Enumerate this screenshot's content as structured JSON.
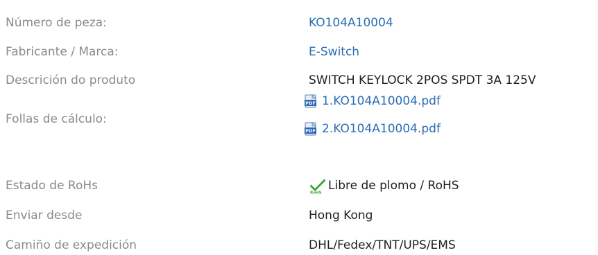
{
  "rows": {
    "part_number": {
      "label": "Número de peza:",
      "value": "KO104A10004"
    },
    "manufacturer": {
      "label": "Fabricante / Marca:",
      "value": "E-Switch"
    },
    "description": {
      "label": "Descrición do produto",
      "value": "SWITCH KEYLOCK 2POS SPDT 3A 125V"
    },
    "datasheets": {
      "label": "Follas de cálculo:",
      "files": [
        "1.KO104A10004.pdf",
        "2.KO104A10004.pdf"
      ],
      "icon": "pdf-icon"
    },
    "rohs": {
      "label": "Estado de RoHs",
      "value": "Libre de plomo / RoHS",
      "icon": "rohs-check-icon"
    },
    "ship_from": {
      "label": "Enviar desde",
      "value": "Hong Kong"
    },
    "shipping": {
      "label": "Camiño de expedición",
      "value": "DHL/Fedex/TNT/UPS/EMS"
    }
  },
  "colors": {
    "label": "#8a8a8a",
    "link": "#2a6db3",
    "value": "#1f1f1f",
    "check": "#3aa335"
  }
}
